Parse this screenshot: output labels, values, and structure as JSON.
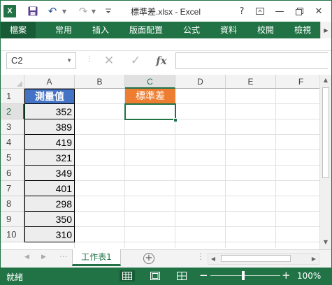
{
  "window": {
    "title": "標準差.xlsx - Excel",
    "help_label": "?",
    "restore_label": "▫",
    "minimize_label": "—",
    "close_label": "✕"
  },
  "quick_access": {
    "app_icon_label": "X",
    "save_icon": "save-icon",
    "undo_icon": "undo-icon",
    "redo_icon": "redo-icon"
  },
  "ribbon": {
    "tabs": [
      "檔案",
      "常用",
      "插入",
      "版面配置",
      "公式",
      "資料",
      "校閱",
      "檢視"
    ]
  },
  "formula_bar": {
    "name_box": "C2",
    "cancel_label": "✕",
    "enter_label": "✓",
    "fx_label": "fx",
    "formula": ""
  },
  "grid": {
    "columns": [
      "A",
      "B",
      "C",
      "D",
      "E",
      "F"
    ],
    "rows": [
      "1",
      "2",
      "3",
      "4",
      "5",
      "6",
      "7",
      "8",
      "9",
      "10"
    ],
    "selected_column": "C",
    "selected_row": "2",
    "header_A1": "測量值",
    "header_C1": "標準差",
    "values_A": [
      "352",
      "389",
      "419",
      "321",
      "349",
      "401",
      "298",
      "350",
      "310"
    ],
    "colors": {
      "header_blue": "#4472c4",
      "header_orange": "#ed7d31",
      "accent_green": "#217346"
    }
  },
  "sheets": {
    "tabs": [
      "工作表1"
    ],
    "add_label": "+"
  },
  "status": {
    "ready": "就緒",
    "zoom_minus": "−",
    "zoom_plus": "+",
    "zoom_level": "100%",
    "zoom_fraction": 0.5
  }
}
